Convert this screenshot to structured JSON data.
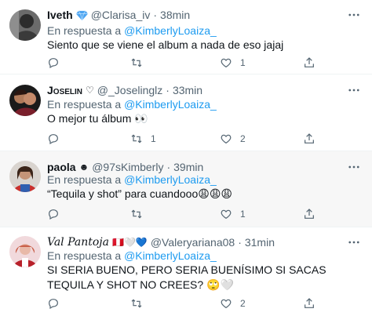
{
  "tweets": [
    {
      "name": "Iveth",
      "name_extra": "",
      "badge": "blue-diamond",
      "handle": "@Clarisa_iv",
      "time": "38min",
      "reply_label": "En respuesta a",
      "reply_mention": "@KimberlyLoaiza_",
      "text": "Siento que se viene el album a nada de eso jajaj",
      "reply_count": "",
      "retweet_count": "",
      "like_count": "1"
    },
    {
      "name": "Joselin",
      "name_extra": "♡",
      "badge": "",
      "handle": "@_Joselinglz",
      "time": "33min",
      "reply_label": "En respuesta a",
      "reply_mention": "@KimberlyLoaiza_",
      "text": "O mejor tu álbum 👀",
      "reply_count": "",
      "retweet_count": "1",
      "like_count": "2"
    },
    {
      "name": "paola",
      "name_extra": "☻",
      "badge": "",
      "handle": "@97sKimberly",
      "time": "39min",
      "reply_label": "En respuesta a",
      "reply_mention": "@KimberlyLoaiza_",
      "text": "“Tequila y shot” para cuandooo😩😩😩",
      "reply_count": "",
      "retweet_count": "",
      "like_count": "1"
    },
    {
      "name": "Val Pantoja",
      "name_extra": "🇵🇪🤍💙",
      "badge": "",
      "handle": "@Valeryariana08",
      "time": "31min",
      "reply_label": "En respuesta a",
      "reply_mention": "@KimberlyLoaiza_",
      "text": "SI SERIA BUENO, PERO SERIA BUENÍSIMO SI SACAS TEQUILA Y SHOT NO CREES? 🙄🤍",
      "reply_count": "",
      "retweet_count": "",
      "like_count": "2"
    }
  ],
  "ui": {
    "separator": "·",
    "colors": {
      "text": "#0f1419",
      "muted": "#536471",
      "link": "#1d9bf0",
      "verified": "#1d9bf0",
      "highlight_bg": "#f7f7f7"
    },
    "icons": [
      "reply-icon",
      "retweet-icon",
      "like-icon",
      "share-icon",
      "more-icon",
      "diamond-icon"
    ]
  }
}
